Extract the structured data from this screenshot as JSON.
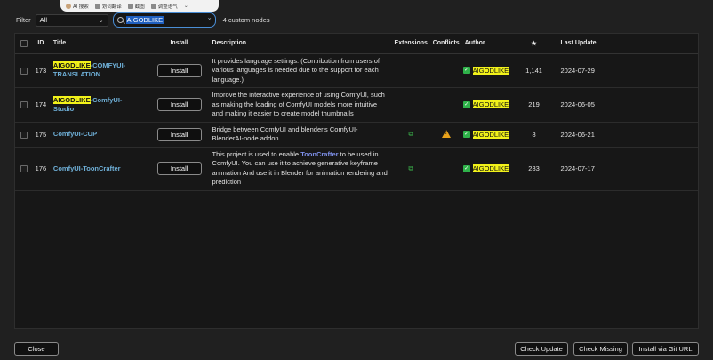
{
  "floatbar": {
    "items": [
      {
        "icon": "ai-avatar-icon",
        "label": "AI 搜索"
      },
      {
        "icon": "translate-icon",
        "label": "划词翻译"
      },
      {
        "icon": "screenshot-icon",
        "label": "截图"
      },
      {
        "icon": "voice-icon",
        "label": "调整语气"
      }
    ],
    "more": "⌄"
  },
  "filter": {
    "label": "Filter",
    "selected": "All",
    "search_value": "AIGODLIKE",
    "node_count": "4 custom nodes"
  },
  "table": {
    "columns": {
      "id": "ID",
      "title": "Title",
      "install": "Install",
      "description": "Description",
      "extensions": "Extensions",
      "conflicts": "Conflicts",
      "author": "Author",
      "stars": "★",
      "last_update": "Last Update"
    },
    "rows": [
      {
        "id": "173",
        "title_hl": "AIGODLIKE",
        "title_rest": "-COMFYUI-TRANSLATION",
        "install": "Install",
        "desc_pre": "It provides language settings. (Contribution from users of various languages is needed due to the support for each language.)",
        "desc_link": "",
        "desc_post": "",
        "has_ext": false,
        "has_conflict": false,
        "author": "AIGODLIKE",
        "stars": "1,141",
        "last_update": "2024-07-29"
      },
      {
        "id": "174",
        "title_hl": "AIGODLIKE",
        "title_rest": "-ComfyUI-Studio",
        "install": "Install",
        "desc_pre": "Improve the interactive experience of using ComfyUI, such as making the loading of ComfyUI models more intuitive and making it easier to create model thumbnails",
        "desc_link": "",
        "desc_post": "",
        "has_ext": false,
        "has_conflict": false,
        "author": "AIGODLIKE",
        "stars": "219",
        "last_update": "2024-06-05"
      },
      {
        "id": "175",
        "title_hl": "",
        "title_rest": "ComfyUI-CUP",
        "install": "Install",
        "desc_pre": "Bridge between ComfyUI and blender's ComfyUI-BlenderAI-node addon.",
        "desc_link": "",
        "desc_post": "",
        "has_ext": true,
        "has_conflict": true,
        "author": "AIGODLIKE",
        "stars": "8",
        "last_update": "2024-06-21"
      },
      {
        "id": "176",
        "title_hl": "",
        "title_rest": "ComfyUI-ToonCrafter",
        "install": "Install",
        "desc_pre": "This project is used to enable ",
        "desc_link": "ToonCrafter",
        "desc_post": " to be used in ComfyUI. You can use it to achieve generative keyframe animation And use it in Blender for animation rendering and prediction",
        "has_ext": true,
        "has_conflict": false,
        "author": "AIGODLIKE",
        "stars": "283",
        "last_update": "2024-07-17"
      }
    ]
  },
  "buttons": {
    "close": "Close",
    "check_update": "Check Update",
    "check_missing": "Check Missing",
    "install_git": "Install via Git URL"
  },
  "colors": {
    "highlight": "#f2f21a",
    "title_link": "#6fb0d8",
    "verified": "#2fb24a",
    "warning": "#e8a21b",
    "search_border": "#4a8ed6"
  }
}
